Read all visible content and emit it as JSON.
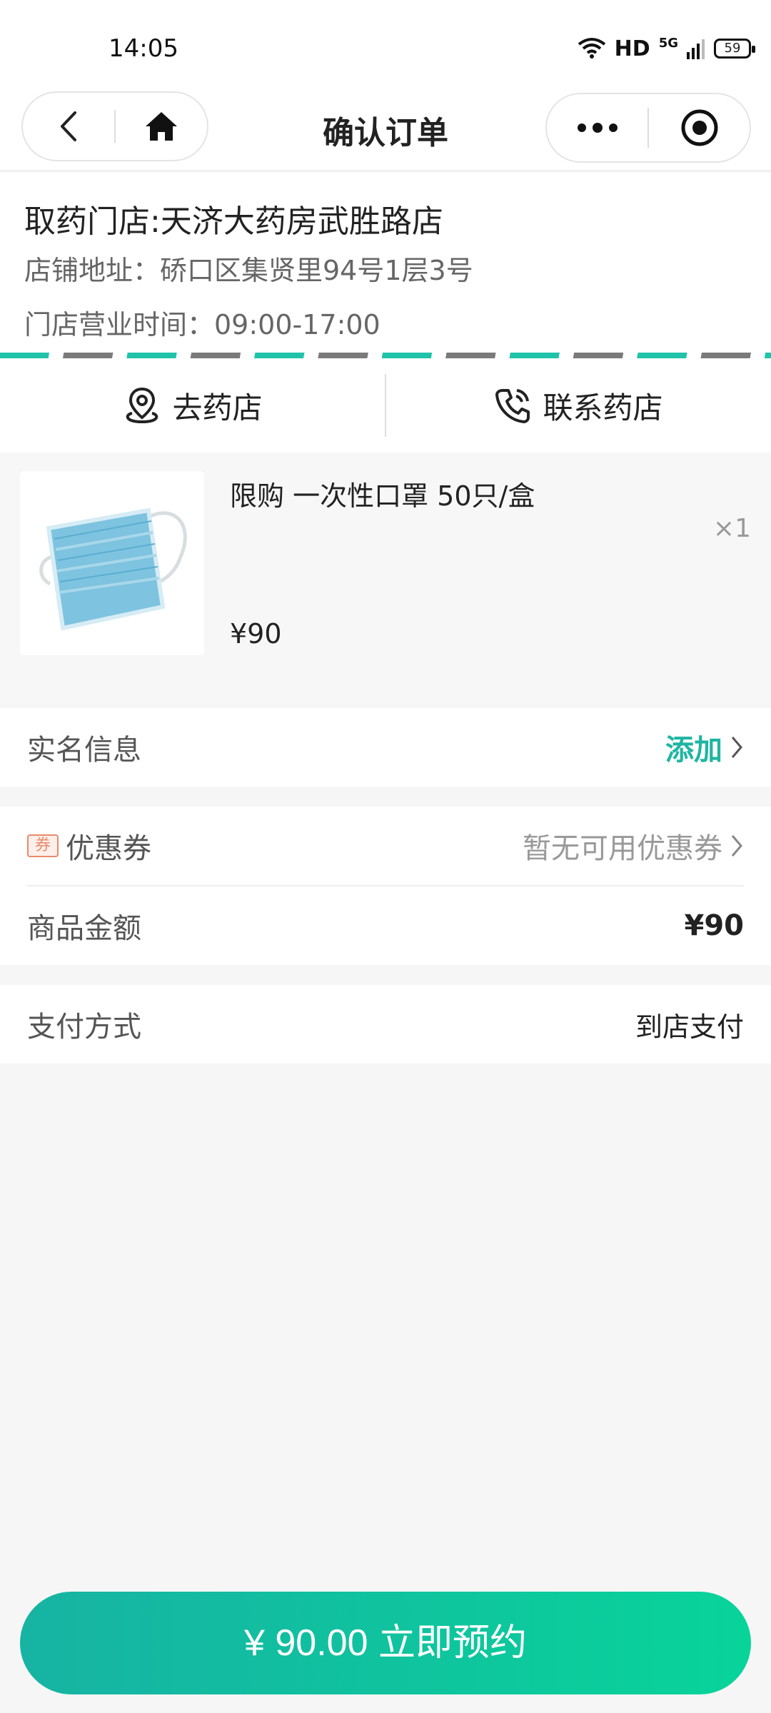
{
  "status_bar": {
    "time": "14:05",
    "network": "HD",
    "signal": "5G",
    "battery": "59"
  },
  "nav": {
    "title": "确认订单",
    "back_icon": "chevron-left-icon",
    "home_icon": "home-icon",
    "more_icon": "more-dots-icon",
    "record_icon": "record-circle-icon"
  },
  "store": {
    "name": "取药门店:天济大药房武胜路店",
    "address": "店铺地址：硚口区集贤里94号1层3号",
    "hours": "门店营业时间：09:00-17:00",
    "stripe_colors": [
      "#20c3a9",
      "#7a7a7a"
    ]
  },
  "actions": {
    "go_store": "去药店",
    "contact_store": "联系药店"
  },
  "product": {
    "name": "限购 一次性口罩 50只/盒",
    "quantity": "×1",
    "price": "¥90"
  },
  "real_name": {
    "label": "实名信息",
    "action": "添加",
    "action_color": "#1fb5a2"
  },
  "coupon": {
    "icon_text": "券",
    "label": "优惠券",
    "value": "暂无可用优惠券"
  },
  "amount": {
    "label": "商品金额",
    "value": "¥90"
  },
  "payment": {
    "label": "支付方式",
    "value": "到店支付"
  },
  "submit": {
    "label": "¥ 90.00 立即预约"
  }
}
